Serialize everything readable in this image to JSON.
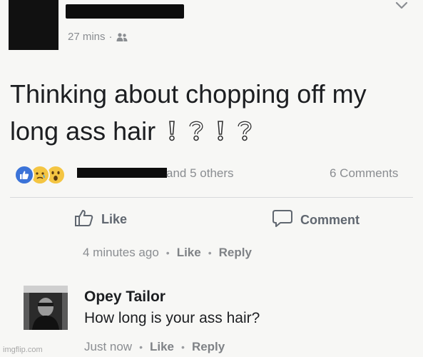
{
  "post": {
    "time": "27 mins",
    "separator": "·",
    "audience_icon": "friends-icon",
    "text": "Thinking about chopping off my long ass hair",
    "punctuation": [
      "exclamation-icon",
      "question-icon",
      "exclamation-icon",
      "question-icon"
    ]
  },
  "reactions": {
    "icons": [
      "like-reaction-icon",
      "sad-reaction-icon",
      "wow-reaction-icon"
    ],
    "others_text": "and 5 others",
    "comments_count": "6 Comments"
  },
  "actions": {
    "like_label": "Like",
    "comment_label": "Comment"
  },
  "previous_comment_meta": {
    "time": "4 minutes ago",
    "like": "Like",
    "reply": "Reply"
  },
  "comment": {
    "author": "Opey Tailor",
    "text": "How long is your ass hair?",
    "time": "Just now",
    "like": "Like",
    "reply": "Reply"
  },
  "watermark": "imgflip.com",
  "colors": {
    "like_blue": "#3b73d8",
    "reaction_yellow": "#f4c542",
    "secondary_text": "#8a8d91",
    "background": "#f7f7f5"
  }
}
